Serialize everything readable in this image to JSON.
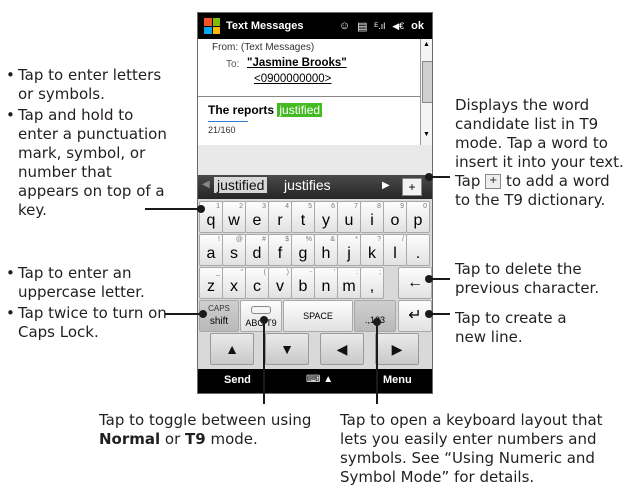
{
  "phone": {
    "titlebar": {
      "app_title": "Text Messages",
      "speech_icon": "☺",
      "list_icon": "▤",
      "signal_icon": "ᴱ.ıl",
      "speaker_icon": "◀€",
      "ok_label": "ok"
    },
    "header": {
      "from_line": "From: (Text Messages)",
      "to_label": "To:",
      "to_name": "\"Jasmine Brooks\"",
      "to_number": "<0900000000>"
    },
    "message": {
      "text_before": "The reports ",
      "highlighted_word": "justified",
      "counter": "21/160"
    },
    "candidates": {
      "left_arrow": "◀",
      "selected": "justified",
      "other": "justifies",
      "right_arrow": "▶",
      "add_button": "+"
    },
    "keyboard": {
      "row1": [
        {
          "main": "q",
          "sym": "1"
        },
        {
          "main": "w",
          "sym": "2"
        },
        {
          "main": "e",
          "sym": "3"
        },
        {
          "main": "r",
          "sym": "4"
        },
        {
          "main": "t",
          "sym": "5"
        },
        {
          "main": "y",
          "sym": "6"
        },
        {
          "main": "u",
          "sym": "7"
        },
        {
          "main": "i",
          "sym": "8"
        },
        {
          "main": "o",
          "sym": "9"
        },
        {
          "main": "p",
          "sym": "0"
        }
      ],
      "row2": [
        {
          "main": "a",
          "sym": "!"
        },
        {
          "main": "s",
          "sym": "@"
        },
        {
          "main": "d",
          "sym": "#"
        },
        {
          "main": "f",
          "sym": "$"
        },
        {
          "main": "g",
          "sym": "%"
        },
        {
          "main": "h",
          "sym": "&"
        },
        {
          "main": "j",
          "sym": "*"
        },
        {
          "main": "k",
          "sym": "?"
        },
        {
          "main": "l",
          "sym": "/"
        },
        {
          "main": ".",
          "sym": ""
        }
      ],
      "row3": [
        {
          "main": "z",
          "sym": "_"
        },
        {
          "main": "x",
          "sym": "\""
        },
        {
          "main": "c",
          "sym": "("
        },
        {
          "main": "v",
          "sym": ")"
        },
        {
          "main": "b",
          "sym": "-"
        },
        {
          "main": "n",
          "sym": "'"
        },
        {
          "main": "m",
          "sym": ":"
        },
        {
          "main": ",",
          "sym": ";"
        }
      ],
      "backspace": "←",
      "caps_label": "CAPS",
      "shift_label": "shift",
      "t9_toggle": "ABC T9",
      "space_label": "SPACE",
      "numeric_label": ".,123",
      "enter": "↵",
      "nav": [
        "▲",
        "▼",
        "◀",
        "▶"
      ]
    },
    "softkeys": {
      "left": "Send",
      "middle": "⌨ ▲",
      "right": "Menu"
    }
  },
  "callouts": {
    "left_top": [
      "Tap to enter letters or symbols.",
      "Tap and hold to enter a punctuation mark, symbol, or number that appears on top of a key."
    ],
    "left_bottom": [
      "Tap to enter an uppercase letter.",
      "Tap twice to turn on Caps Lock."
    ],
    "right_candidates_1": "Displays the word candidate list in T9 mode. Tap a word to insert it into your text.",
    "right_candidates_2_pre": "Tap",
    "right_candidates_2_icon": "+",
    "right_candidates_2_post": "to add a word to the T9 dictionary.",
    "right_delete": "Tap to delete the previous character.",
    "right_newline": "Tap to create a new line.",
    "bottom_toggle_pre": "Tap to toggle between using ",
    "bottom_toggle_normal": "Normal",
    "bottom_toggle_or": " or ",
    "bottom_toggle_t9": "T9",
    "bottom_toggle_post": " mode.",
    "bottom_numeric": "Tap to open a keyboard layout that lets you easily enter numbers and symbols. See “Using Numeric and Symbol Mode” for details."
  }
}
